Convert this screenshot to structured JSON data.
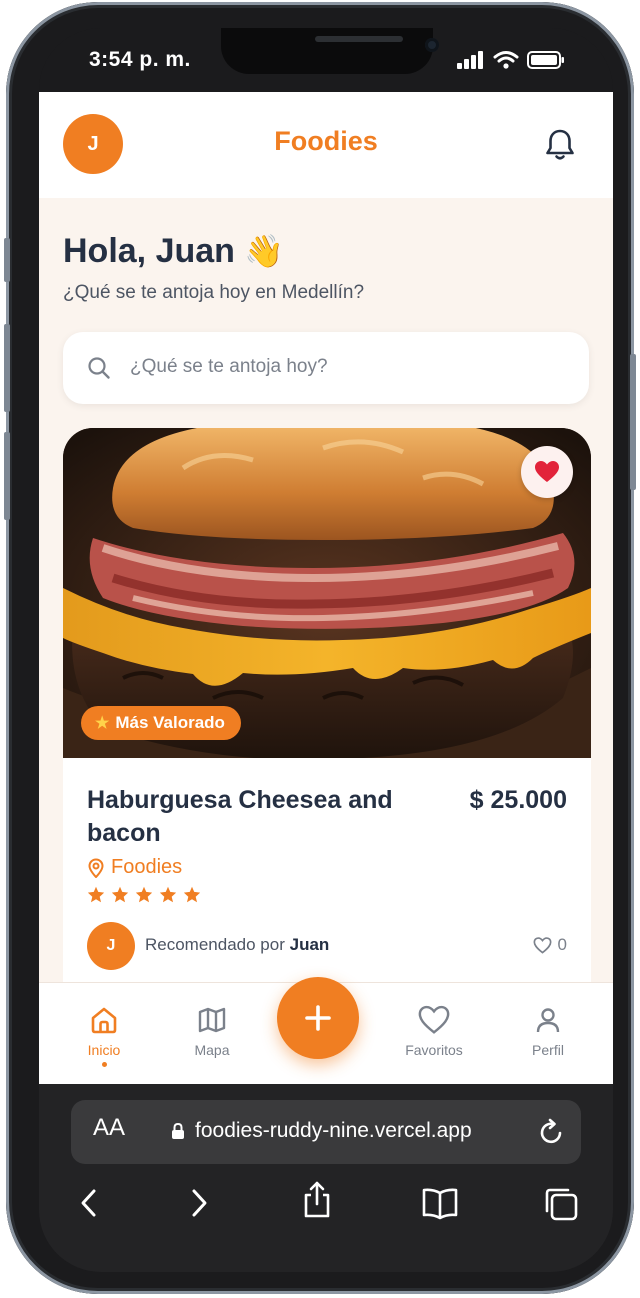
{
  "status": {
    "time": "3:54 p. m."
  },
  "header": {
    "avatar_initial": "J",
    "brand": "Foodies"
  },
  "greeting": {
    "title": "Hola, Juan",
    "emoji": "👋",
    "subtitle": "¿Qué se te antoja hoy en Medellín?"
  },
  "search": {
    "placeholder": "¿Qué se te antoja hoy?"
  },
  "card": {
    "badge": "Más Valorado",
    "title": "Haburguesa Cheesea and bacon",
    "price": "$ 25.000",
    "location": "Foodies",
    "rating": 5,
    "favorited": true,
    "recommender_initial": "J",
    "recommended_prefix": "Recomendado por",
    "recommender_name": "Juan",
    "likes": "0"
  },
  "nav": {
    "home": "Inicio",
    "map": "Mapa",
    "favorites": "Favoritos",
    "profile": "Perfil"
  },
  "browser": {
    "aa": "AA",
    "url": "foodies-ruddy-nine.vercel.app"
  },
  "colors": {
    "accent": "#f07e22",
    "text_dark": "#253043",
    "bg": "#fbf4ee"
  }
}
